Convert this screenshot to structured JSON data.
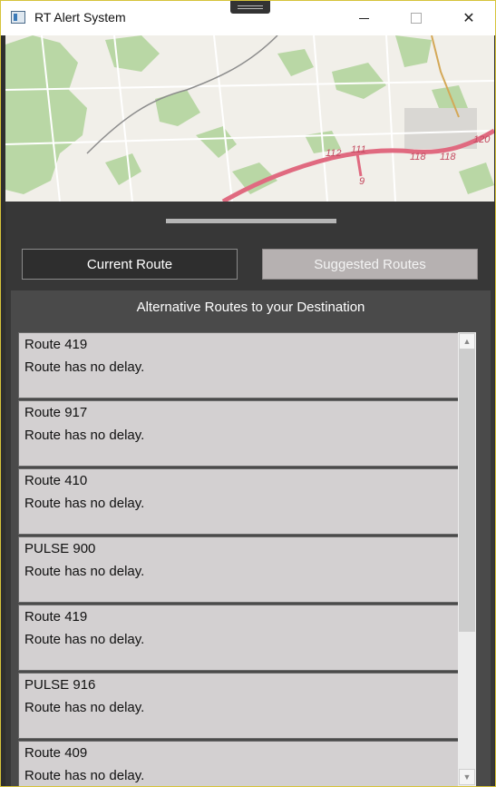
{
  "window": {
    "title": "RT Alert System",
    "icons": {
      "app": "app-window-icon",
      "minimize": "minimize-icon",
      "maximize": "maximize-icon",
      "close": "close-icon"
    },
    "close_glyph": "✕"
  },
  "map": {
    "route_labels": [
      "112",
      "111",
      "9",
      "118",
      "118",
      "120"
    ],
    "colors": {
      "highway": "#e06a80",
      "park": "#b9d7a5",
      "background": "#f1efe9"
    }
  },
  "tabs": {
    "current_label": "Current Route",
    "suggested_label": "Suggested Routes",
    "active": "Suggested Routes"
  },
  "list": {
    "header": "Alternative Routes to your Destination",
    "routes": [
      {
        "name": "Route 419",
        "status": "Route has no delay."
      },
      {
        "name": "Route 917",
        "status": "Route has no delay."
      },
      {
        "name": "Route 410",
        "status": "Route has no delay."
      },
      {
        "name": "PULSE 900",
        "status": "Route has no delay."
      },
      {
        "name": "Route 419",
        "status": "Route has no delay."
      },
      {
        "name": "PULSE 916",
        "status": "Route has no delay."
      },
      {
        "name": "Route 409",
        "status": "Route has no delay."
      }
    ]
  },
  "scrollbar": {
    "up_glyph": "▲",
    "down_glyph": "▼"
  }
}
